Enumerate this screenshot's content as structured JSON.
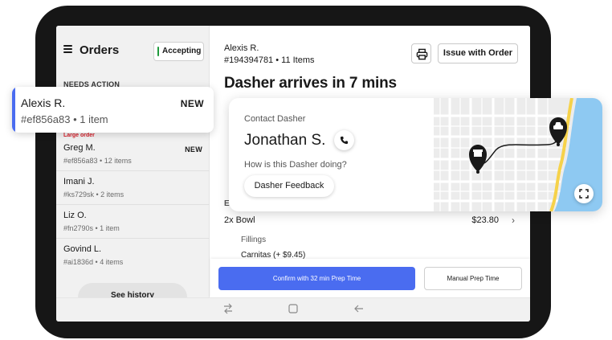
{
  "sidebar": {
    "title": "Orders",
    "status_button": "Accepting",
    "section_label": "NEEDS ACTION",
    "orders": [
      {
        "tag": "Large order",
        "name": "Greg M.",
        "meta": "#ef856a83 • 12 items",
        "badge": "NEW"
      },
      {
        "name": "Imani J.",
        "meta": "#ks729sk • 2 items"
      },
      {
        "name": "Liz O.",
        "meta": "#fn2790s • 1 item"
      },
      {
        "name": "Govind L.",
        "meta": "#ai1836d • 4 items"
      }
    ],
    "history_button": "See history"
  },
  "highlighted_order": {
    "name": "Alexis R.",
    "meta": "#ef856a83 • 1 item",
    "badge": "NEW",
    "accent_color": "#4a6cf0"
  },
  "order_detail": {
    "customer_name": "Alexis R.",
    "order_meta": "#194394781 • 11 Items",
    "issue_button": "Issue with Order",
    "eta_headline": "Dasher arrives in 7 mins",
    "section_partial": "En",
    "item": {
      "quantity_name": "2x Bowl",
      "price": "$23.80"
    },
    "option_group": "Fillings",
    "option_value": "Carnitas (+ $9.45)",
    "confirm_button": "Confirm with 32 min Prep Time",
    "manual_button": "Manual Prep Time"
  },
  "dasher_card": {
    "contact_label": "Contact Dasher",
    "dasher_name": "Jonathan S.",
    "question": "How is this Dasher doing?",
    "feedback_button": "Dasher Feedback"
  },
  "nav_bar": {
    "recents_icon": "recents-icon",
    "home_icon": "home-icon",
    "back_icon": "back-icon"
  },
  "colors": {
    "primary": "#4a6cf0",
    "accepting_green": "#1f9a3c",
    "large_order_red": "#d8202b",
    "map_water": "#8ec9f2",
    "map_highway": "#f6d24a"
  }
}
